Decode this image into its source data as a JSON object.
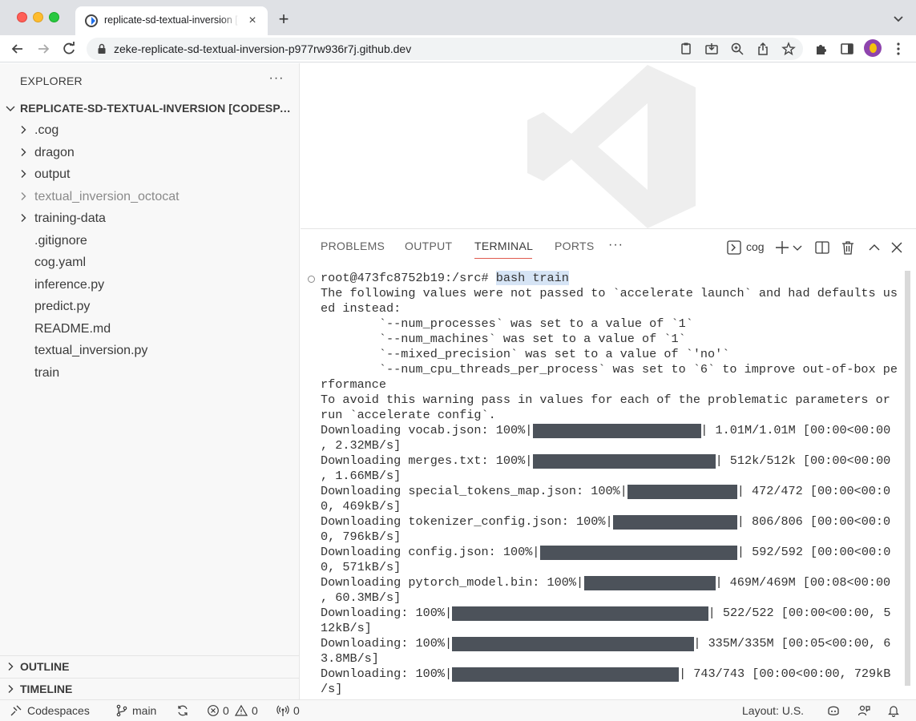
{
  "browser": {
    "tab_title": "replicate-sd-textual-inversion [Codespaces]",
    "url": "zeke-replicate-sd-textual-inversion-p977rw936r7j.github.dev"
  },
  "sidebar": {
    "title": "EXPLORER",
    "root_label": "REPLICATE-SD-TEXTUAL-INVERSION [CODESPACES]",
    "items": [
      {
        "label": ".cog",
        "type": "folder"
      },
      {
        "label": "dragon",
        "type": "folder"
      },
      {
        "label": "output",
        "type": "folder"
      },
      {
        "label": "textual_inversion_octocat",
        "type": "folder",
        "dimmed": true
      },
      {
        "label": "training-data",
        "type": "folder"
      },
      {
        "label": ".gitignore",
        "type": "file"
      },
      {
        "label": "cog.yaml",
        "type": "file"
      },
      {
        "label": "inference.py",
        "type": "file"
      },
      {
        "label": "predict.py",
        "type": "file"
      },
      {
        "label": "README.md",
        "type": "file"
      },
      {
        "label": "textual_inversion.py",
        "type": "file"
      },
      {
        "label": "train",
        "type": "file"
      }
    ],
    "sections": [
      "OUTLINE",
      "TIMELINE"
    ]
  },
  "panel": {
    "tabs": [
      "PROBLEMS",
      "OUTPUT",
      "TERMINAL",
      "PORTS"
    ],
    "active_tab": "TERMINAL",
    "shell_name": "cog"
  },
  "terminal": {
    "prompt": "root@473fc8752b19:/src# ",
    "command": "bash train",
    "lines": [
      "The following values were not passed to `accelerate launch` and had defaults us",
      "ed instead:",
      "        `--num_processes` was set to a value of `1`",
      "        `--num_machines` was set to a value of `1`",
      "        `--mixed_precision` was set to a value of `'no'`",
      "        `--num_cpu_threads_per_process` was set to `6` to improve out-of-box pe",
      "rformance",
      "To avoid this warning pass in values for each of the problematic parameters or",
      "run `accelerate config`."
    ],
    "downloads": [
      {
        "prefix": "Downloading vocab.json: 100%|",
        "suffix": "| 1.01M/1.01M [00:00<00:00",
        "wrap": ", 2.32MB/s]",
        "progress": 1.0
      },
      {
        "prefix": "Downloading merges.txt: 100%|",
        "suffix": "| 512k/512k [00:00<00:00",
        "wrap": ", 1.66MB/s]",
        "progress": 1.0
      },
      {
        "prefix": "Downloading special_tokens_map.json: 100%|",
        "suffix": "| 472/472 [00:00<00:0",
        "wrap": "0, 469kB/s]",
        "progress": 1.0
      },
      {
        "prefix": "Downloading tokenizer_config.json: 100%|",
        "suffix": "| 806/806 [00:00<00:0",
        "wrap": "0, 796kB/s]",
        "progress": 1.0
      },
      {
        "prefix": "Downloading config.json: 100%|",
        "suffix": "| 592/592 [00:00<00:0",
        "wrap": "0, 571kB/s]",
        "progress": 1.0
      },
      {
        "prefix": "Downloading pytorch_model.bin: 100%|",
        "suffix": "| 469M/469M [00:08<00:00",
        "wrap": ", 60.3MB/s]",
        "progress": 1.0
      },
      {
        "prefix": "Downloading: 100%|",
        "suffix": "| 522/522 [00:00<00:00, 5",
        "wrap": "12kB/s]",
        "progress": 1.0
      },
      {
        "prefix": "Downloading: 100%|",
        "suffix": "| 335M/335M [00:05<00:00, 6",
        "wrap": "3.8MB/s]",
        "progress": 1.0
      },
      {
        "prefix": "Downloading: 100%|",
        "suffix": "| 743/743 [00:00<00:00, 729kB",
        "wrap": "/s]",
        "progress": 1.0
      }
    ]
  },
  "statusbar": {
    "remote": "Codespaces",
    "branch": "main",
    "errors": "0",
    "warnings": "0",
    "ports": "0",
    "layout": "Layout: U.S."
  },
  "colors": {
    "accent_underline": "#e05a4e",
    "progress_bar": "#4c525a",
    "sidebar_bg": "#f8f8f8"
  }
}
